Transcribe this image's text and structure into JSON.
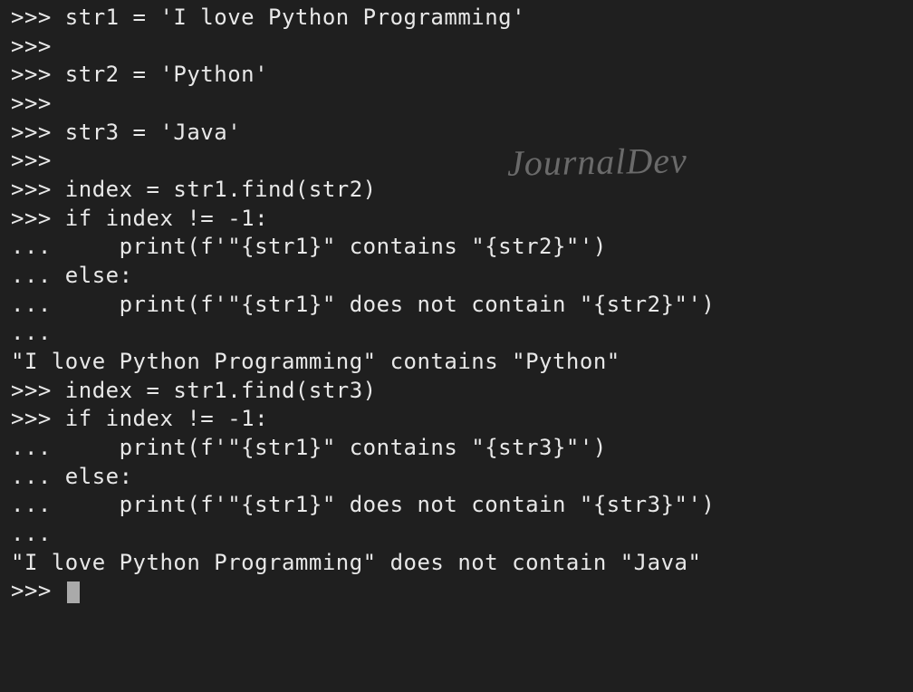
{
  "watermark": "JournalDev",
  "lines": [
    {
      "prompt": ">>> ",
      "text": "str1 = 'I love Python Programming'"
    },
    {
      "prompt": ">>> ",
      "text": ""
    },
    {
      "prompt": ">>> ",
      "text": "str2 = 'Python'"
    },
    {
      "prompt": ">>> ",
      "text": ""
    },
    {
      "prompt": ">>> ",
      "text": "str3 = 'Java'"
    },
    {
      "prompt": ">>> ",
      "text": ""
    },
    {
      "prompt": ">>> ",
      "text": "index = str1.find(str2)"
    },
    {
      "prompt": ">>> ",
      "text": "if index != -1:"
    },
    {
      "prompt": "... ",
      "text": "    print(f'\"{str1}\" contains \"{str2}\"')"
    },
    {
      "prompt": "... ",
      "text": "else:"
    },
    {
      "prompt": "... ",
      "text": "    print(f'\"{str1}\" does not contain \"{str2}\"')"
    },
    {
      "prompt": "... ",
      "text": ""
    },
    {
      "prompt": "",
      "text": "\"I love Python Programming\" contains \"Python\""
    },
    {
      "prompt": ">>> ",
      "text": "index = str1.find(str3)"
    },
    {
      "prompt": ">>> ",
      "text": "if index != -1:"
    },
    {
      "prompt": "... ",
      "text": "    print(f'\"{str1}\" contains \"{str3}\"')"
    },
    {
      "prompt": "... ",
      "text": "else:"
    },
    {
      "prompt": "... ",
      "text": "    print(f'\"{str1}\" does not contain \"{str3}\"')"
    },
    {
      "prompt": "... ",
      "text": ""
    },
    {
      "prompt": "",
      "text": "\"I love Python Programming\" does not contain \"Java\""
    }
  ],
  "final_prompt": ">>> "
}
